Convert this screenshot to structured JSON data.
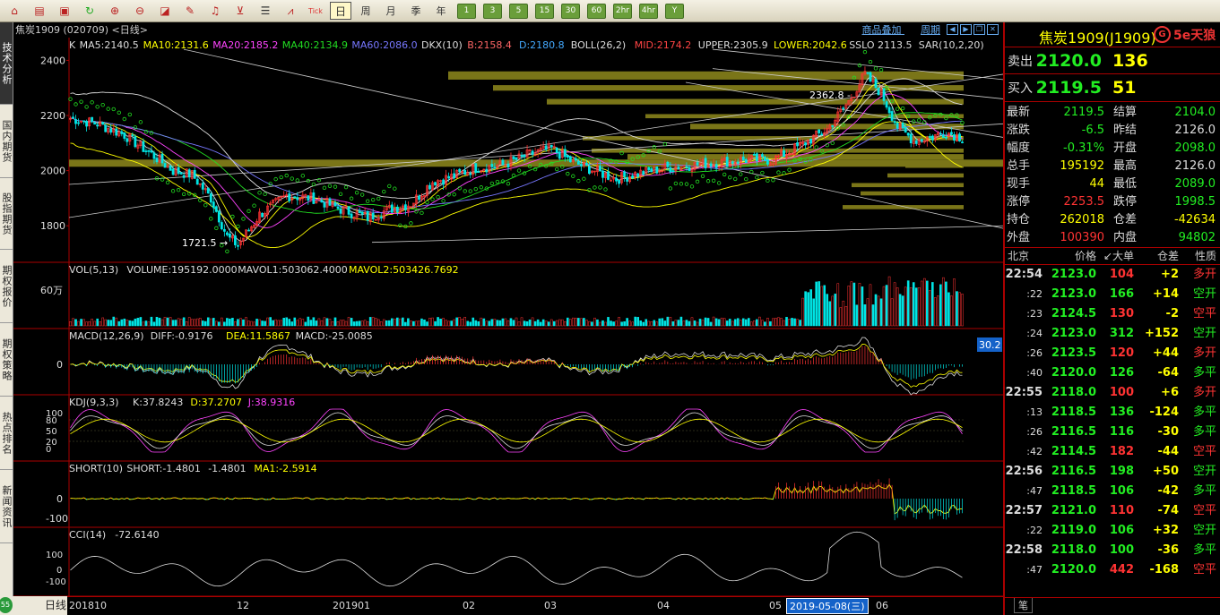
{
  "toolbar": {
    "periods": [
      "周",
      "月",
      "季",
      "年"
    ],
    "per_buttons": [
      "1",
      "3",
      "5",
      "15",
      "30",
      "60",
      "2hr",
      "4hr",
      "Y"
    ]
  },
  "sidebar": {
    "tabs": [
      "技术分析",
      "国内期货",
      "股指期货",
      "期权报价",
      "期权策略",
      "热点排名",
      "新闻资讯"
    ]
  },
  "chart_header": {
    "title": "焦炭1909 (020709) <日线>",
    "link1": "商品叠加",
    "link2": "周期"
  },
  "indicators": {
    "main": [
      {
        "text": "K",
        "color": "#dddddd"
      },
      {
        "text": "MA5:2140.5",
        "color": "#dddddd"
      },
      {
        "text": "MA10:2131.6",
        "color": "#ffff00"
      },
      {
        "text": "MA20:2185.2",
        "color": "#ff44ff"
      },
      {
        "text": "MA40:2134.9",
        "color": "#22dd22"
      },
      {
        "text": "MA60:2086.0",
        "color": "#7777ff"
      },
      {
        "text": "DKX(10)",
        "color": "#dddddd"
      },
      {
        "text": "B:2158.4",
        "color": "#ff6666"
      },
      {
        "text": "D:2180.8",
        "color": "#44aaff"
      },
      {
        "text": "BOLL(26,2)",
        "color": "#dddddd"
      },
      {
        "text": "MID:2174.2",
        "color": "#ff4444"
      },
      {
        "text": "UPPER:2305.9",
        "color": "#dddddd"
      },
      {
        "text": "LOWER:2042.6",
        "color": "#ffff00"
      },
      {
        "text": "SSLO 2113.5",
        "color": "#dddddd"
      },
      {
        "text": "SAR(10,2,20)",
        "color": "#dddddd"
      }
    ],
    "vol": [
      {
        "text": "VOL(5,13)",
        "color": "#dddddd"
      },
      {
        "text": "VOLUME:195192.0000",
        "color": "#dddddd"
      },
      {
        "text": "MAVOL1:503062.4000",
        "color": "#dddddd"
      },
      {
        "text": "MAVOL2:503426.7692",
        "color": "#ffff00"
      }
    ],
    "macd": [
      {
        "text": "MACD(12,26,9)",
        "color": "#dddddd"
      },
      {
        "text": "DIFF:-0.9176",
        "color": "#dddddd"
      },
      {
        "text": "DEA:11.5867",
        "color": "#ffff00"
      },
      {
        "text": "MACD:-25.0085",
        "color": "#dddddd"
      }
    ],
    "kdj": [
      {
        "text": "KDJ(9,3,3)",
        "color": "#dddddd"
      },
      {
        "text": "K:37.8243",
        "color": "#dddddd"
      },
      {
        "text": "D:37.2707",
        "color": "#ffff00"
      },
      {
        "text": "J:38.9316",
        "color": "#ff44ff"
      }
    ],
    "short": [
      {
        "text": "SHORT(10)",
        "color": "#dddddd"
      },
      {
        "text": "SHORT:-1.4801",
        "color": "#dddddd"
      },
      {
        "text": "-1.4801",
        "color": "#dddddd"
      },
      {
        "text": "MA1:-2.5914",
        "color": "#ffff00"
      }
    ],
    "cci": [
      {
        "text": "CCI(14)",
        "color": "#dddddd"
      },
      {
        "text": "-72.6140",
        "color": "#dddddd"
      }
    ]
  },
  "axes": {
    "price_ticks": [
      "2400",
      "2200",
      "2000",
      "1800"
    ],
    "vol_tick": "60万",
    "macd_tick": "0",
    "kdj_ticks": [
      "100",
      "80",
      "50",
      "20",
      "0"
    ],
    "short_ticks": [
      "0",
      "-100"
    ],
    "cci_ticks": [
      "100",
      "0",
      "-100"
    ],
    "macd_box": "30.2",
    "x_labels": [
      "201810",
      "12",
      "201901",
      "02",
      "03",
      "04",
      "05",
      "06"
    ],
    "x_date": "2019-05-08(三)",
    "high_label": "2362.8",
    "low_label": "1721.5"
  },
  "right_panel": {
    "name": "焦炭1909(J1909)",
    "logo": "5e天狼",
    "sell_label": "卖出",
    "sell_price": "2120.0",
    "sell_vol": "136",
    "buy_label": "买入",
    "buy_price": "2119.5",
    "buy_vol": "51",
    "stats": [
      {
        "l1": "最新",
        "v1": "2119.5",
        "c1": "g",
        "l2": "结算",
        "v2": "2104.0",
        "c2": "g"
      },
      {
        "l1": "涨跌",
        "v1": "-6.5",
        "c1": "g",
        "l2": "昨结",
        "v2": "2126.0",
        "c2": "w"
      },
      {
        "l1": "幅度",
        "v1": "-0.31%",
        "c1": "g",
        "l2": "开盘",
        "v2": "2098.0",
        "c2": "g"
      },
      {
        "l1": "总手",
        "v1": "195192",
        "c1": "y",
        "l2": "最高",
        "v2": "2126.0",
        "c2": "w"
      },
      {
        "l1": "现手",
        "v1": "44",
        "c1": "y",
        "l2": "最低",
        "v2": "2089.0",
        "c2": "g"
      },
      {
        "l1": "涨停",
        "v1": "2253.5",
        "c1": "r",
        "l2": "跌停",
        "v2": "1998.5",
        "c2": "g"
      },
      {
        "l1": "持仓",
        "v1": "262018",
        "c1": "y",
        "l2": "仓差",
        "v2": "-42634",
        "c2": "y"
      },
      {
        "l1": "外盘",
        "v1": "100390",
        "c1": "r",
        "l2": "内盘",
        "v2": "94802",
        "c2": "g"
      }
    ],
    "tick_header": [
      "北京",
      "价格",
      "↙大单",
      "仓差",
      "性质"
    ],
    "ticks": [
      {
        "t": "22:54",
        "main": true,
        "p": "2123.0",
        "v": "104",
        "vc": "r",
        "c": "+2",
        "cc": "y",
        "n": "多开",
        "nc": "r"
      },
      {
        "t": ":22",
        "main": false,
        "p": "2123.0",
        "v": "166",
        "vc": "g",
        "c": "+14",
        "cc": "y",
        "n": "空开",
        "nc": "g"
      },
      {
        "t": ":23",
        "main": false,
        "p": "2124.5",
        "v": "130",
        "vc": "r",
        "c": "-2",
        "cc": "y",
        "n": "空平",
        "nc": "r"
      },
      {
        "t": ":24",
        "main": false,
        "p": "2123.0",
        "v": "312",
        "vc": "g",
        "c": "+152",
        "cc": "y",
        "n": "空开",
        "nc": "g"
      },
      {
        "t": ":26",
        "main": false,
        "p": "2123.5",
        "v": "120",
        "vc": "r",
        "c": "+44",
        "cc": "y",
        "n": "多开",
        "nc": "r"
      },
      {
        "t": ":40",
        "main": false,
        "p": "2120.0",
        "v": "126",
        "vc": "g",
        "c": "-64",
        "cc": "y",
        "n": "多平",
        "nc": "g"
      },
      {
        "t": "22:55",
        "main": true,
        "p": "2118.0",
        "v": "100",
        "vc": "r",
        "c": "+6",
        "cc": "y",
        "n": "多开",
        "nc": "r"
      },
      {
        "t": ":13",
        "main": false,
        "p": "2118.5",
        "v": "136",
        "vc": "g",
        "c": "-124",
        "cc": "y",
        "n": "多平",
        "nc": "g"
      },
      {
        "t": ":26",
        "main": false,
        "p": "2116.5",
        "v": "116",
        "vc": "g",
        "c": "-30",
        "cc": "y",
        "n": "多平",
        "nc": "g"
      },
      {
        "t": ":42",
        "main": false,
        "p": "2114.5",
        "v": "182",
        "vc": "r",
        "c": "-44",
        "cc": "y",
        "n": "空平",
        "nc": "r"
      },
      {
        "t": "22:56",
        "main": true,
        "p": "2116.5",
        "v": "198",
        "vc": "g",
        "c": "+50",
        "cc": "y",
        "n": "空开",
        "nc": "g"
      },
      {
        "t": ":47",
        "main": false,
        "p": "2118.5",
        "v": "106",
        "vc": "g",
        "c": "-42",
        "cc": "y",
        "n": "多平",
        "nc": "g"
      },
      {
        "t": "22:57",
        "main": true,
        "p": "2121.0",
        "v": "110",
        "vc": "r",
        "c": "-74",
        "cc": "y",
        "n": "空平",
        "nc": "r"
      },
      {
        "t": ":22",
        "main": false,
        "p": "2119.0",
        "v": "106",
        "vc": "g",
        "c": "+32",
        "cc": "y",
        "n": "空开",
        "nc": "g"
      },
      {
        "t": "22:58",
        "main": true,
        "p": "2118.0",
        "v": "100",
        "vc": "g",
        "c": "-36",
        "cc": "y",
        "n": "多平",
        "nc": "g"
      },
      {
        "t": ":47",
        "main": false,
        "p": "2120.0",
        "v": "442",
        "vc": "r",
        "c": "-168",
        "cc": "y",
        "n": "空平",
        "nc": "r"
      }
    ],
    "foot_tab": "笔"
  },
  "bottom": {
    "period_label": "日线",
    "badge": "55"
  }
}
